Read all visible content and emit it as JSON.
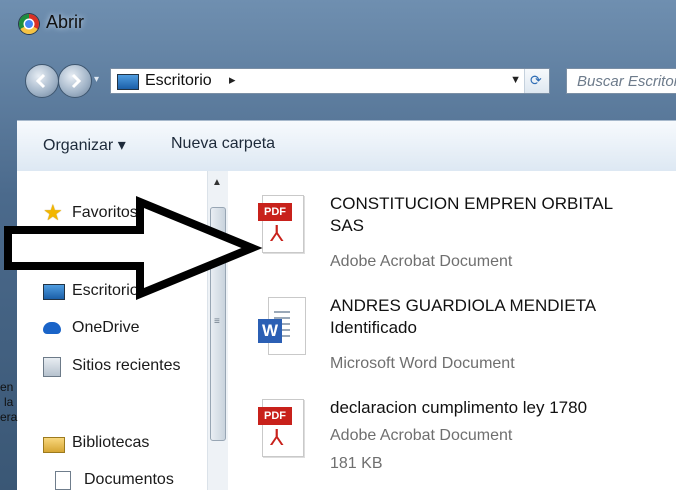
{
  "window": {
    "title": "Abrir"
  },
  "address_bar": {
    "location": "Escritorio",
    "separator": "▸",
    "search_placeholder": "Buscar Escritorio"
  },
  "toolbar": {
    "organize_label": "Organizar ▾",
    "new_folder_label": "Nueva carpeta"
  },
  "nav_pane": {
    "items": [
      {
        "label": "Favoritos",
        "icon": "star-icon"
      },
      {
        "label": "Escritorio",
        "icon": "desktop-icon"
      },
      {
        "label": "OneDrive",
        "icon": "onedrive-icon"
      },
      {
        "label": "Sitios recientes",
        "icon": "recent-places-icon"
      },
      {
        "label": "Bibliotecas",
        "icon": "libraries-icon"
      },
      {
        "label": "Documentos",
        "icon": "documents-icon"
      }
    ]
  },
  "files": [
    {
      "name_line1": "CONSTITUCION EMPREN ORBITAL",
      "name_line2": "SAS",
      "type": "Adobe Acrobat Document",
      "icon": "pdf-icon",
      "icon_text": "PDF"
    },
    {
      "name_line1": "ANDRES GUARDIOLA MENDIETA",
      "name_line2": "Identificado",
      "type": "Microsoft Word Document",
      "icon": "word-icon",
      "icon_text": "W"
    },
    {
      "name_line1": "declaracion cumplimento ley 1780",
      "type": "Adobe Acrobat Document",
      "size": "181 KB",
      "icon": "pdf-icon",
      "icon_text": "PDF"
    }
  ],
  "edge_text": [
    "en",
    "la",
    "era"
  ],
  "colors": {
    "accent": "#2b5fb4",
    "pdf_red": "#c8211b",
    "frame_blue": "#4b6a8c"
  }
}
